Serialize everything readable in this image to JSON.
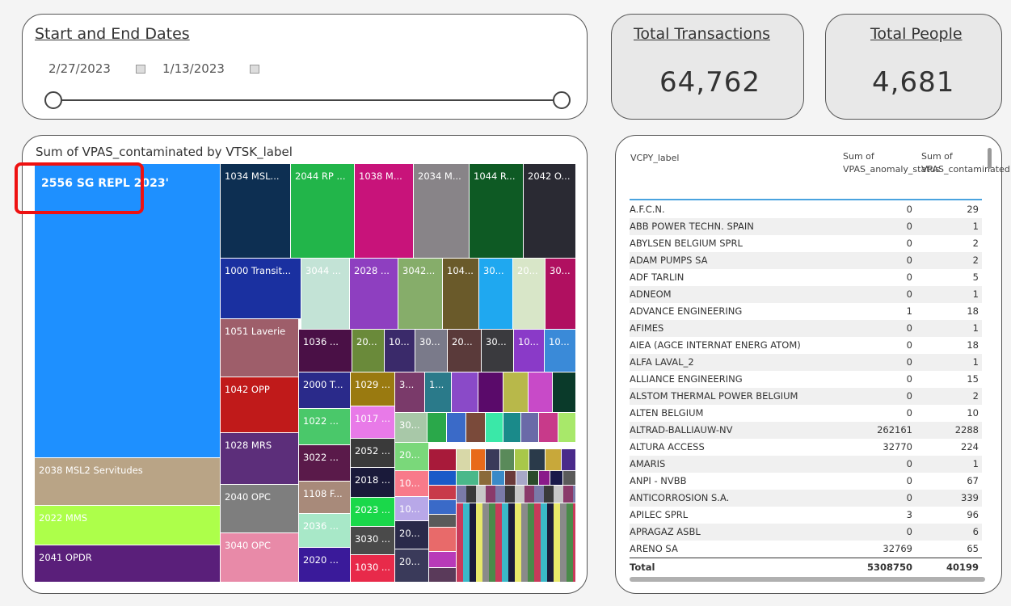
{
  "date_filter": {
    "title": "Start and End Dates",
    "start": "2/27/2023",
    "end": "1/13/2023"
  },
  "kpi_transactions": {
    "title": "Total Transactions",
    "value": "64,762"
  },
  "kpi_people": {
    "title": "Total People",
    "value": "4,681"
  },
  "treemap": {
    "title": "Sum of VPAS_contaminated by VTSK_label",
    "labels": {
      "t2556": "2556 SG REPL 2023'",
      "t2038": "2038 MSL2 Servitudes",
      "t2022": "2022 MMS",
      "t2041": "2041 OPDR",
      "t1034": "1034 MSL...",
      "t2044": "2044 RP ...",
      "t1038": "1038 M...",
      "t2034": "2034 M...",
      "t1044": "1044 R...",
      "t2042": "2042 O...",
      "t1000": "1000 Transit...",
      "t3044": "3044 ...",
      "t2028": "2028 ...",
      "t3042": "3042...",
      "t104": "104...",
      "t30a": "30...",
      "t20a": "20...",
      "t30b": "30...",
      "t1051": "1051 Laverie",
      "t1036": "1036 ...",
      "t20b": "20...",
      "t10a": "10...",
      "t30c": "30...",
      "t20c": "20...",
      "t30d": "30...",
      "t10b": "10...",
      "t10c": "10...",
      "t1042": "1042 OPP",
      "t2000": "2000 T...",
      "t1029": "1029 ...",
      "t3a": "3...",
      "t1a": "1...",
      "t1022": "1022 ...",
      "t1017": "1017 ...",
      "t30e": "30...",
      "t1028": "1028 MRS",
      "t3022": "3022 ...",
      "t2052": "2052 ...",
      "t20d": "20...",
      "t2040": "2040 OPC",
      "t1108": "1108 F...",
      "t2018": "2018 ...",
      "t10d": "10...",
      "t2036": "2036 ...",
      "t2023": "2023 ...",
      "t10e": "10...",
      "t3040": "3040 OPC",
      "t3030": "3030 ...",
      "t20e": "20...",
      "t2020": "2020 ...",
      "t1030": "1030 ...",
      "t20f": "20..."
    }
  },
  "table": {
    "headers": {
      "label": "VCPY_label",
      "col1": "Sum of VPAS_anomaly_status",
      "col2": "Sum of VPAS_contaminated"
    },
    "rows": [
      {
        "label": "A.F.C.N.",
        "a": "0",
        "c": "29"
      },
      {
        "label": "ABB POWER TECHN. SPAIN",
        "a": "0",
        "c": "1"
      },
      {
        "label": "ABYLSEN BELGIUM SPRL",
        "a": "0",
        "c": "2"
      },
      {
        "label": "ADAM PUMPS SA",
        "a": "0",
        "c": "2"
      },
      {
        "label": "ADF TARLIN",
        "a": "0",
        "c": "5"
      },
      {
        "label": "ADNEOM",
        "a": "0",
        "c": "1"
      },
      {
        "label": "ADVANCE ENGINEERING",
        "a": "1",
        "c": "18"
      },
      {
        "label": "AFIMES",
        "a": "0",
        "c": "1"
      },
      {
        "label": "AIEA (AGCE INTERNAT ENERG ATOM)",
        "a": "0",
        "c": "18"
      },
      {
        "label": "ALFA LAVAL_2",
        "a": "0",
        "c": "1"
      },
      {
        "label": "ALLIANCE ENGINEERING",
        "a": "0",
        "c": "15"
      },
      {
        "label": "ALSTOM THERMAL POWER BELGIUM",
        "a": "0",
        "c": "2"
      },
      {
        "label": "ALTEN BELGIUM",
        "a": "0",
        "c": "10"
      },
      {
        "label": "ALTRAD-BALLIAUW-NV",
        "a": "262161",
        "c": "2288"
      },
      {
        "label": "ALTURA ACCESS",
        "a": "32770",
        "c": "224"
      },
      {
        "label": "AMARIS",
        "a": "0",
        "c": "1"
      },
      {
        "label": "ANPI - NVBB",
        "a": "0",
        "c": "67"
      },
      {
        "label": "ANTICORROSION S.A.",
        "a": "0",
        "c": "339"
      },
      {
        "label": "APILEC SPRL",
        "a": "3",
        "c": "96"
      },
      {
        "label": "APRAGAZ ASBL",
        "a": "0",
        "c": "6"
      },
      {
        "label": "ARENO SA",
        "a": "32769",
        "c": "65"
      }
    ],
    "total": {
      "label": "Total",
      "a": "5308750",
      "c": "40199"
    }
  },
  "colors": {
    "accent_blue": "#1e90ff",
    "highlight_red": "#e11111"
  }
}
